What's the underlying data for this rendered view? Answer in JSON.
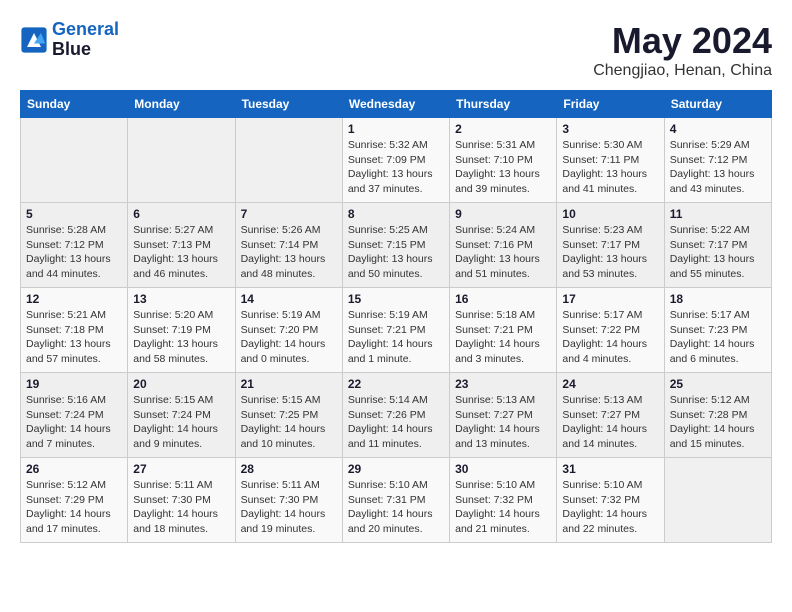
{
  "logo": {
    "line1": "General",
    "line2": "Blue"
  },
  "title": "May 2024",
  "location": "Chengjiao, Henan, China",
  "weekdays": [
    "Sunday",
    "Monday",
    "Tuesday",
    "Wednesday",
    "Thursday",
    "Friday",
    "Saturday"
  ],
  "weeks": [
    [
      {
        "day": "",
        "info": ""
      },
      {
        "day": "",
        "info": ""
      },
      {
        "day": "",
        "info": ""
      },
      {
        "day": "1",
        "info": "Sunrise: 5:32 AM\nSunset: 7:09 PM\nDaylight: 13 hours\nand 37 minutes."
      },
      {
        "day": "2",
        "info": "Sunrise: 5:31 AM\nSunset: 7:10 PM\nDaylight: 13 hours\nand 39 minutes."
      },
      {
        "day": "3",
        "info": "Sunrise: 5:30 AM\nSunset: 7:11 PM\nDaylight: 13 hours\nand 41 minutes."
      },
      {
        "day": "4",
        "info": "Sunrise: 5:29 AM\nSunset: 7:12 PM\nDaylight: 13 hours\nand 43 minutes."
      }
    ],
    [
      {
        "day": "5",
        "info": "Sunrise: 5:28 AM\nSunset: 7:12 PM\nDaylight: 13 hours\nand 44 minutes."
      },
      {
        "day": "6",
        "info": "Sunrise: 5:27 AM\nSunset: 7:13 PM\nDaylight: 13 hours\nand 46 minutes."
      },
      {
        "day": "7",
        "info": "Sunrise: 5:26 AM\nSunset: 7:14 PM\nDaylight: 13 hours\nand 48 minutes."
      },
      {
        "day": "8",
        "info": "Sunrise: 5:25 AM\nSunset: 7:15 PM\nDaylight: 13 hours\nand 50 minutes."
      },
      {
        "day": "9",
        "info": "Sunrise: 5:24 AM\nSunset: 7:16 PM\nDaylight: 13 hours\nand 51 minutes."
      },
      {
        "day": "10",
        "info": "Sunrise: 5:23 AM\nSunset: 7:17 PM\nDaylight: 13 hours\nand 53 minutes."
      },
      {
        "day": "11",
        "info": "Sunrise: 5:22 AM\nSunset: 7:17 PM\nDaylight: 13 hours\nand 55 minutes."
      }
    ],
    [
      {
        "day": "12",
        "info": "Sunrise: 5:21 AM\nSunset: 7:18 PM\nDaylight: 13 hours\nand 57 minutes."
      },
      {
        "day": "13",
        "info": "Sunrise: 5:20 AM\nSunset: 7:19 PM\nDaylight: 13 hours\nand 58 minutes."
      },
      {
        "day": "14",
        "info": "Sunrise: 5:19 AM\nSunset: 7:20 PM\nDaylight: 14 hours\nand 0 minutes."
      },
      {
        "day": "15",
        "info": "Sunrise: 5:19 AM\nSunset: 7:21 PM\nDaylight: 14 hours\nand 1 minute."
      },
      {
        "day": "16",
        "info": "Sunrise: 5:18 AM\nSunset: 7:21 PM\nDaylight: 14 hours\nand 3 minutes."
      },
      {
        "day": "17",
        "info": "Sunrise: 5:17 AM\nSunset: 7:22 PM\nDaylight: 14 hours\nand 4 minutes."
      },
      {
        "day": "18",
        "info": "Sunrise: 5:17 AM\nSunset: 7:23 PM\nDaylight: 14 hours\nand 6 minutes."
      }
    ],
    [
      {
        "day": "19",
        "info": "Sunrise: 5:16 AM\nSunset: 7:24 PM\nDaylight: 14 hours\nand 7 minutes."
      },
      {
        "day": "20",
        "info": "Sunrise: 5:15 AM\nSunset: 7:24 PM\nDaylight: 14 hours\nand 9 minutes."
      },
      {
        "day": "21",
        "info": "Sunrise: 5:15 AM\nSunset: 7:25 PM\nDaylight: 14 hours\nand 10 minutes."
      },
      {
        "day": "22",
        "info": "Sunrise: 5:14 AM\nSunset: 7:26 PM\nDaylight: 14 hours\nand 11 minutes."
      },
      {
        "day": "23",
        "info": "Sunrise: 5:13 AM\nSunset: 7:27 PM\nDaylight: 14 hours\nand 13 minutes."
      },
      {
        "day": "24",
        "info": "Sunrise: 5:13 AM\nSunset: 7:27 PM\nDaylight: 14 hours\nand 14 minutes."
      },
      {
        "day": "25",
        "info": "Sunrise: 5:12 AM\nSunset: 7:28 PM\nDaylight: 14 hours\nand 15 minutes."
      }
    ],
    [
      {
        "day": "26",
        "info": "Sunrise: 5:12 AM\nSunset: 7:29 PM\nDaylight: 14 hours\nand 17 minutes."
      },
      {
        "day": "27",
        "info": "Sunrise: 5:11 AM\nSunset: 7:30 PM\nDaylight: 14 hours\nand 18 minutes."
      },
      {
        "day": "28",
        "info": "Sunrise: 5:11 AM\nSunset: 7:30 PM\nDaylight: 14 hours\nand 19 minutes."
      },
      {
        "day": "29",
        "info": "Sunrise: 5:10 AM\nSunset: 7:31 PM\nDaylight: 14 hours\nand 20 minutes."
      },
      {
        "day": "30",
        "info": "Sunrise: 5:10 AM\nSunset: 7:32 PM\nDaylight: 14 hours\nand 21 minutes."
      },
      {
        "day": "31",
        "info": "Sunrise: 5:10 AM\nSunset: 7:32 PM\nDaylight: 14 hours\nand 22 minutes."
      },
      {
        "day": "",
        "info": ""
      }
    ]
  ]
}
